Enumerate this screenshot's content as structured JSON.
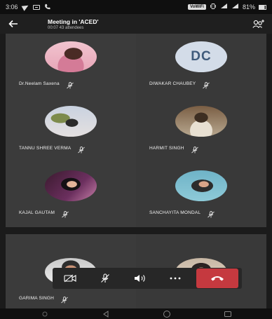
{
  "status_bar": {
    "time": "3:06",
    "network": "VoWiFi",
    "battery": "81%"
  },
  "app_bar": {
    "title": "Meeting in 'ACED'",
    "subtitle": "00:07  43 attendees"
  },
  "participants": [
    {
      "name": "Dr.Neelam Saxena",
      "avatar": "photo",
      "photo_colors": [
        "#e7a5b7",
        "#f2c4cf",
        "#4a2b25"
      ]
    },
    {
      "name": "DIWAKAR CHAUBEY",
      "avatar": "initials",
      "initials": "DC"
    },
    {
      "name": "TANNU SHREE VERMA",
      "avatar": "photo",
      "photo_colors": [
        "#c9d2e0",
        "#e4e0e0",
        "#2a2a2a"
      ]
    },
    {
      "name": "HARMIT SINGH",
      "avatar": "photo",
      "photo_colors": [
        "#b8a890",
        "#7a5e44",
        "#3d2e22"
      ]
    },
    {
      "name": "KAJAL GAUTAM",
      "avatar": "photo",
      "photo_colors": [
        "#3a1a2e",
        "#6b2f5e",
        "#c77fa8"
      ]
    },
    {
      "name": "SANCHAYITA MONDAL",
      "avatar": "photo",
      "photo_colors": [
        "#6fb3c7",
        "#8ecad8",
        "#2c2c2c"
      ]
    },
    {
      "name": "GARIMA SINGH",
      "avatar": "photo",
      "photo_colors": [
        "#c9c9c9",
        "#efefef",
        "#2d2d2d"
      ]
    },
    {
      "name": "",
      "avatar": "photo",
      "photo_colors": [
        "#c7b7a4",
        "#e5d6c7",
        "#2b2322"
      ]
    }
  ],
  "colors": {
    "tile": "#3b3b3b",
    "end_call": "#c5393f",
    "initials_bg": "#d3dce8",
    "initials_fg": "#3e5a7b"
  }
}
